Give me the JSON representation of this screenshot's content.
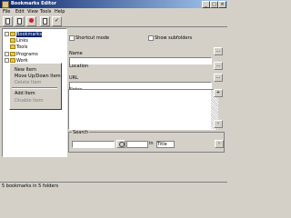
{
  "window": {
    "title": "Bookmarks Editor"
  },
  "menu": [
    "File",
    "Edit",
    "View",
    "Tools",
    "Help"
  ],
  "toolbar": {
    "icons": [
      "new-icon",
      "open-icon",
      "stop-icon",
      "info-icon",
      "check-icon"
    ]
  },
  "tree": {
    "items": [
      {
        "label": "Bookmarks"
      },
      {
        "label": "Links"
      },
      {
        "label": "Tools"
      },
      {
        "label": "Programs"
      },
      {
        "label": "Work"
      }
    ]
  },
  "context_menu": {
    "items": [
      {
        "label": "New Item"
      },
      {
        "label": "Move Up/Down Item"
      },
      {
        "label": "Delete Item"
      },
      {
        "label": "Add Item"
      },
      {
        "label": "Disable Item"
      }
    ]
  },
  "details": {
    "check1": "Shortcut mode",
    "check2": "Show subfolders",
    "name_label": "Name",
    "location_label": "Location",
    "url_label": "URL",
    "notes_label": "Notes"
  },
  "search": {
    "group_label": "Search",
    "in_label": "in",
    "dropdown_value": "Title"
  },
  "status": {
    "text": "5 bookmarks in 5 folders"
  }
}
